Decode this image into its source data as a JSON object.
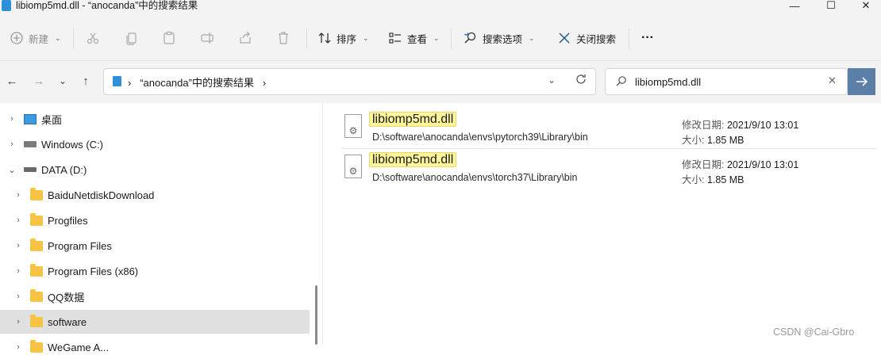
{
  "window": {
    "title": "libiomp5md.dll - “anocanda”中的搜索结果",
    "controls": {
      "minimize": "—",
      "maximize": "☐",
      "close": "✕"
    }
  },
  "toolbar": {
    "new_label": "新建",
    "sort_label": "排序",
    "view_label": "查看",
    "search_options_label": "搜索选项",
    "close_search_label": "关闭搜索",
    "more_label": "···"
  },
  "nav": {
    "back": "←",
    "forward": "→",
    "recent": "⌄",
    "up": "↑"
  },
  "address": {
    "path": "“anocanda”中的搜索结果",
    "separator": "›"
  },
  "search": {
    "value": "libiomp5md.dll",
    "placeholder": ""
  },
  "sidebar": {
    "items": [
      {
        "label": "桌面",
        "icon": "desktop-icon",
        "expanded": false
      },
      {
        "label": "Windows (C:)",
        "icon": "drive-icon",
        "expanded": false
      },
      {
        "label": "DATA (D:)",
        "icon": "drive-icon",
        "expanded": true
      },
      {
        "label": "BaiduNetdiskDownload",
        "icon": "folder-icon",
        "expanded": false
      },
      {
        "label": "Progfiles",
        "icon": "folder-icon",
        "expanded": false
      },
      {
        "label": "Program Files",
        "icon": "folder-icon",
        "expanded": false
      },
      {
        "label": "Program Files (x86)",
        "icon": "folder-icon",
        "expanded": false
      },
      {
        "label": "QQ数据",
        "icon": "folder-icon",
        "expanded": false
      },
      {
        "label": "software",
        "icon": "folder-icon",
        "expanded": false,
        "selected": true
      },
      {
        "label": "WeGame A...",
        "icon": "folder-icon",
        "expanded": false
      }
    ]
  },
  "results": [
    {
      "name": "libiomp5md.dll",
      "path": "D:\\software\\anocanda\\envs\\pytorch39\\Library\\bin",
      "modified_label": "修改日期:",
      "modified": "2021/9/10 13:01",
      "size_label": "大小:",
      "size": "1.85 MB"
    },
    {
      "name": "libiomp5md.dll",
      "path": "D:\\software\\anocanda\\envs\\torch37\\Library\\bin",
      "modified_label": "修改日期:",
      "modified": "2021/9/10 13:01",
      "size_label": "大小:",
      "size": "1.85 MB"
    }
  ],
  "watermark": "CSDN @Cai-Gbro",
  "colors": {
    "highlight": "#fff59a",
    "accent_button": "#5b7fa6",
    "folder": "#f6c342",
    "selected_row": "#e0e0e0"
  }
}
